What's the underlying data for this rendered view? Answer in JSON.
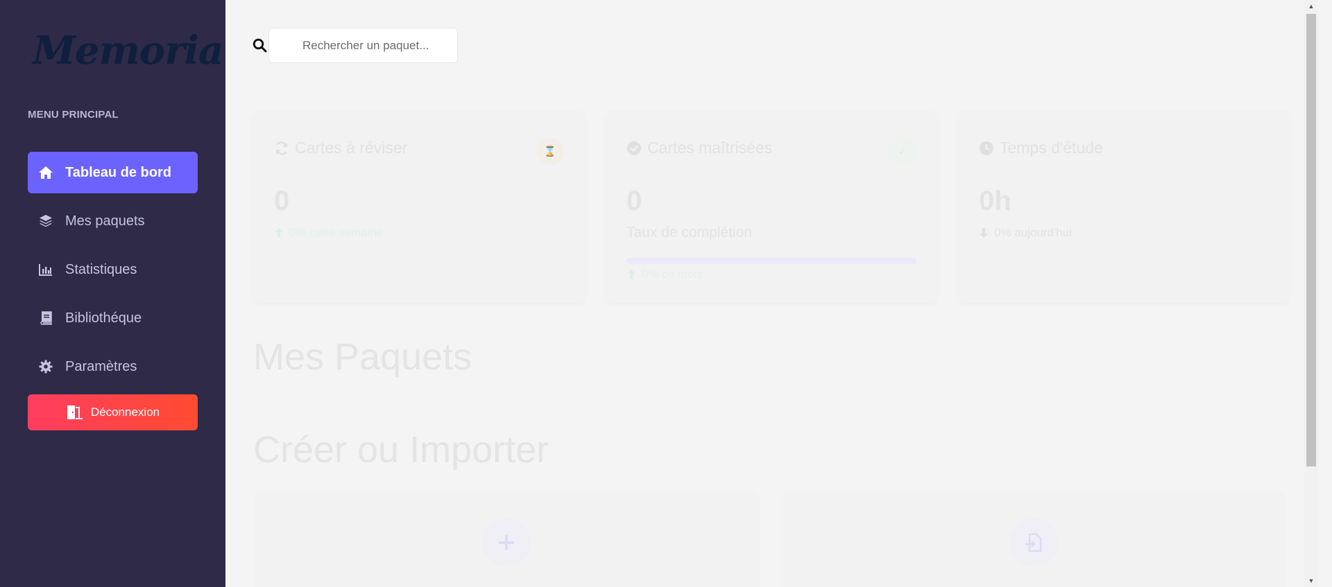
{
  "app": {
    "logo": "Memoria"
  },
  "sidebar": {
    "heading": "MENU PRINCIPAL",
    "items": [
      {
        "label": "Tableau de bord",
        "icon": "home-icon"
      },
      {
        "label": "Mes paquets",
        "icon": "layers-icon"
      },
      {
        "label": "Statistiques",
        "icon": "chart-icon"
      },
      {
        "label": "Bibliothéque",
        "icon": "book-icon"
      },
      {
        "label": "Paramètres",
        "icon": "gear-icon"
      }
    ],
    "logout_label": "Déconnexion"
  },
  "search": {
    "placeholder": "Rechercher un paquet..."
  },
  "stats": {
    "review": {
      "title": "Cartes à réviser",
      "value": "0",
      "trend": "0% cette semaine"
    },
    "mastered": {
      "title": "Cartes maîtrisées",
      "value": "0",
      "subtitle": "Taux de complétion",
      "trend": "0% ce mois",
      "progress": 0
    },
    "time": {
      "title": "Temps d'étude",
      "value": "0h",
      "trend": "0% aujourd'hui"
    }
  },
  "sections": {
    "packs_title": "Mes Paquets",
    "create_title": "Créer ou Importer"
  },
  "colors": {
    "sidebar_bg": "#2e2a48",
    "accent": "#6c63ff",
    "logout": "#ff4147",
    "page_bg": "#f4f4f4"
  }
}
